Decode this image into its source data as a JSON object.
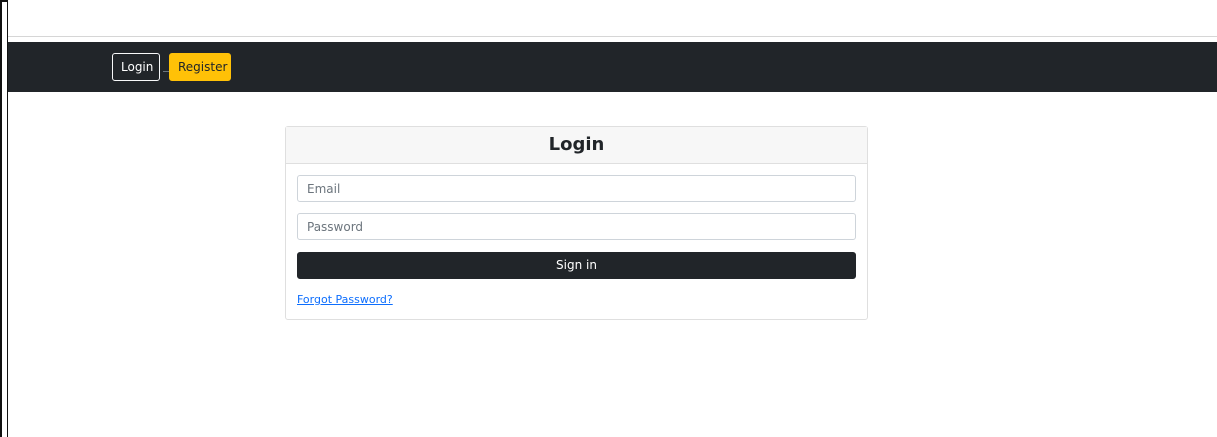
{
  "navbar": {
    "login_label": "Login",
    "register_label": "Register"
  },
  "login_card": {
    "title": "Login",
    "email_placeholder": "Email",
    "password_placeholder": "Password",
    "signin_label": "Sign in",
    "forgot_label": "Forgot Password?"
  },
  "colors": {
    "navbar_bg": "#212529",
    "register_accent": "#ffc107",
    "link": "#0d6efd"
  }
}
